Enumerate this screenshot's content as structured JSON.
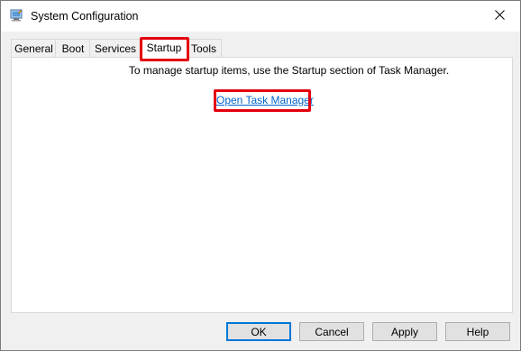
{
  "window": {
    "title": "System Configuration"
  },
  "tabs": [
    {
      "label": "General",
      "selected": false
    },
    {
      "label": "Boot",
      "selected": false
    },
    {
      "label": "Services",
      "selected": false
    },
    {
      "label": "Startup",
      "selected": true
    },
    {
      "label": "Tools",
      "selected": false
    }
  ],
  "startup": {
    "message": "To manage startup items, use the Startup section of Task Manager.",
    "link_label": "Open Task Manager"
  },
  "buttons": {
    "ok": "OK",
    "cancel": "Cancel",
    "apply": "Apply",
    "help": "Help"
  },
  "colors": {
    "highlight": "#e3000f",
    "link": "#0066cc",
    "default_button_border": "#0078d7"
  },
  "icons": {
    "app": "system-configuration-icon",
    "close": "close-icon"
  }
}
